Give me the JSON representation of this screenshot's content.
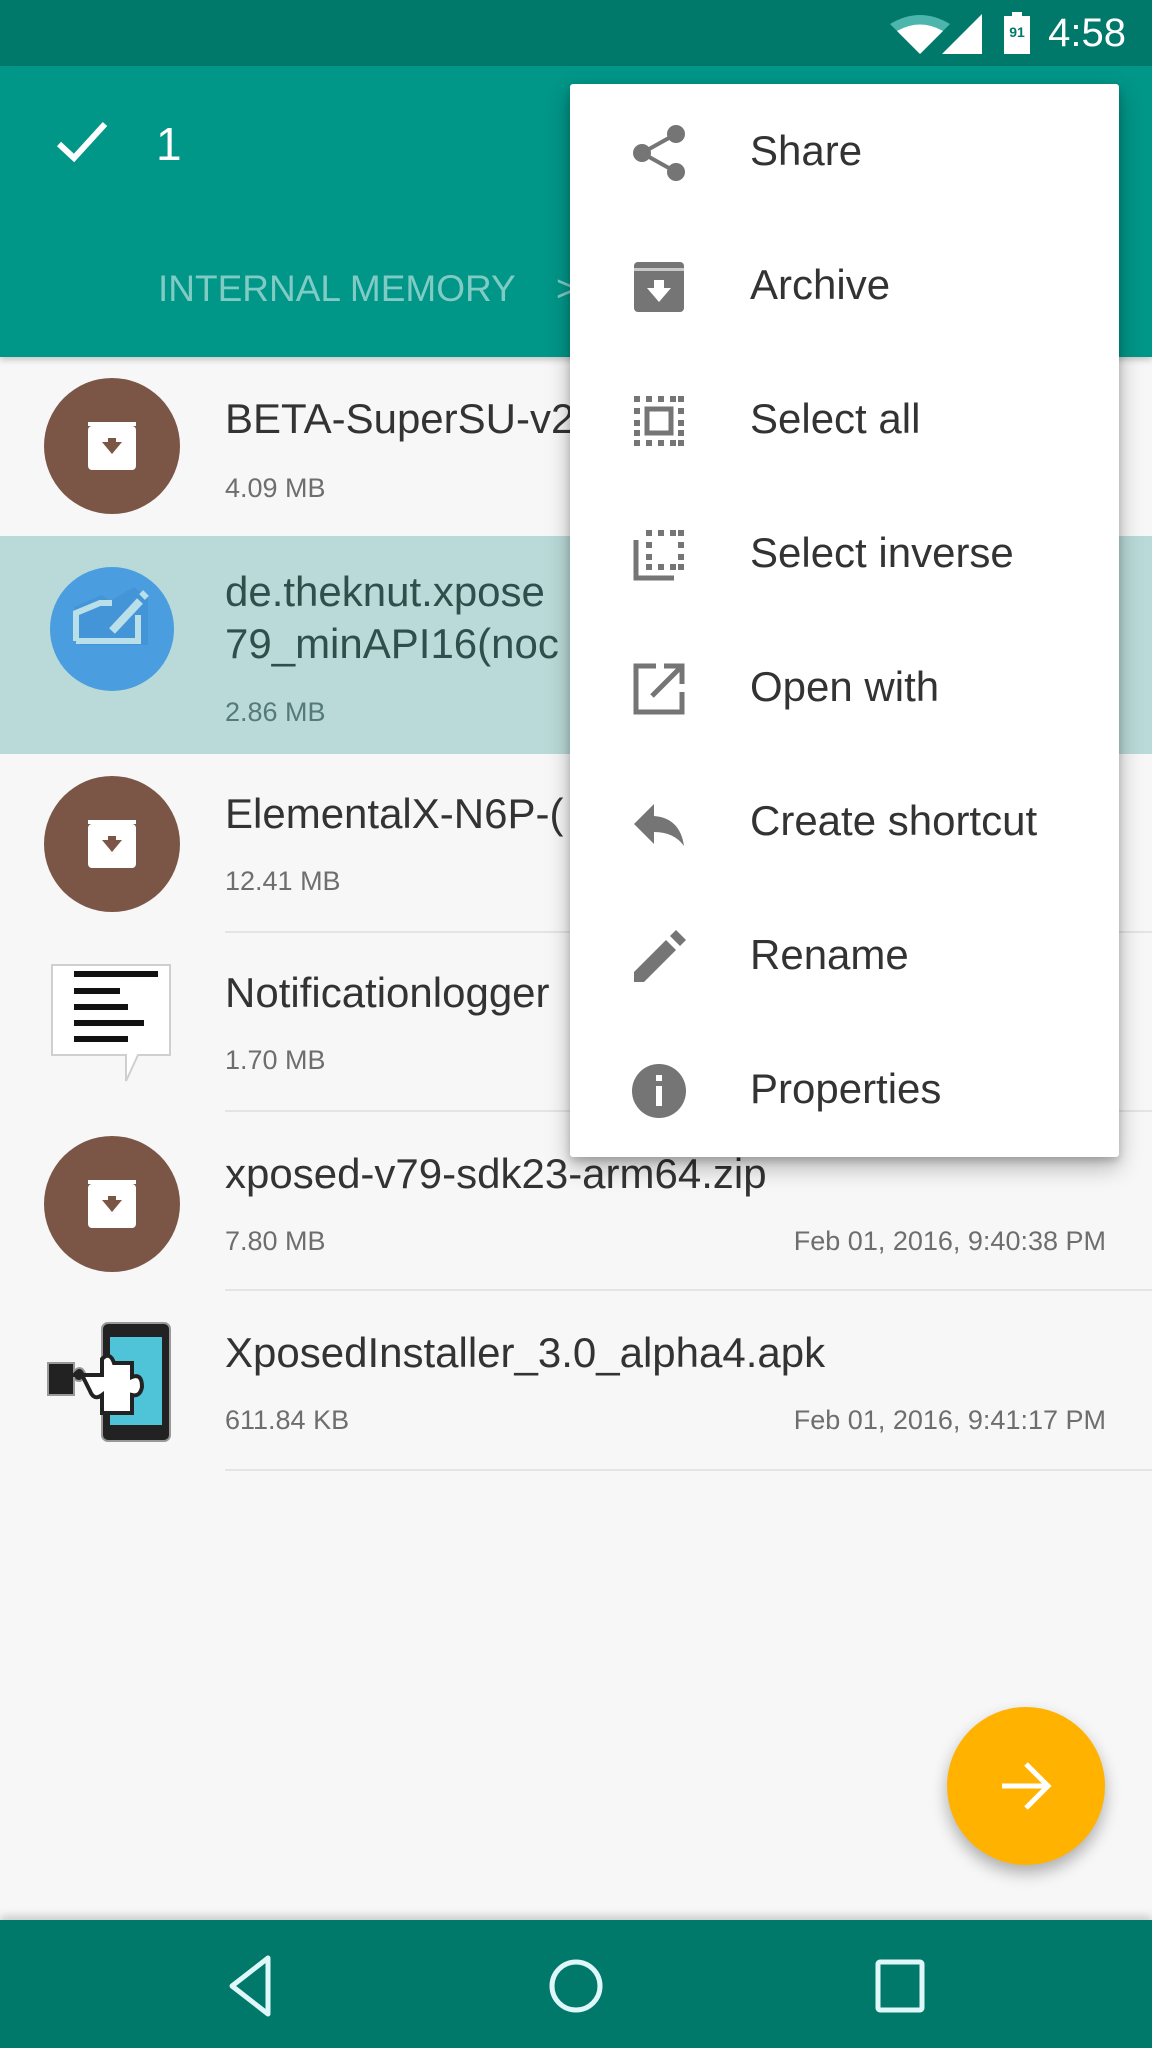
{
  "status_bar": {
    "time": "4:58",
    "battery_level": "91",
    "icons": [
      "wifi-icon",
      "cell-signal-icon",
      "battery-icon"
    ]
  },
  "toolbar": {
    "selected_count": "1",
    "breadcrumb": "INTERNAL MEMORY",
    "breadcrumb_separator": ">",
    "colors": {
      "primary": "#009688",
      "primary_dark": "#00796b",
      "breadcrumb_text": "#80cbc4"
    }
  },
  "files": [
    {
      "name": "BETA-SuperSU-v2",
      "size": "4.09 MB",
      "date": "",
      "icon": "archive-icon",
      "selected": false
    },
    {
      "name": "de.theknut.xpose",
      "name_line2": "79_minAPI16(noc",
      "size": "2.86 MB",
      "date": "",
      "icon": "xposed-module-icon",
      "selected": true
    },
    {
      "name": "ElementalX-N6P-(",
      "size": "12.41 MB",
      "date": "",
      "icon": "archive-icon",
      "selected": false
    },
    {
      "name": "Notificationlogger",
      "size": "1.70 MB",
      "date": "",
      "icon": "notification-logger-icon",
      "selected": false
    },
    {
      "name": "xposed-v79-sdk23-arm64.zip",
      "size": "7.80 MB",
      "date": "Feb 01, 2016, 9:40:38 PM",
      "icon": "archive-icon",
      "selected": false
    },
    {
      "name": "XposedInstaller_3.0_alpha4.apk",
      "size": "611.84 KB",
      "date": "Feb 01, 2016, 9:41:17 PM",
      "icon": "xposed-installer-icon",
      "selected": false
    }
  ],
  "menu": {
    "items": [
      {
        "label": "Share",
        "icon": "share-icon"
      },
      {
        "label": "Archive",
        "icon": "archive-icon"
      },
      {
        "label": "Select all",
        "icon": "select-all-icon"
      },
      {
        "label": "Select inverse",
        "icon": "select-inverse-icon"
      },
      {
        "label": "Open with",
        "icon": "open-with-icon"
      },
      {
        "label": "Create shortcut",
        "icon": "reply-icon"
      },
      {
        "label": "Rename",
        "icon": "pencil-icon"
      },
      {
        "label": "Properties",
        "icon": "info-icon"
      }
    ]
  },
  "fab": {
    "icon": "arrow-right-icon",
    "color": "#ffb300"
  },
  "nav_bar": {
    "buttons": [
      "back-icon",
      "home-icon",
      "recents-icon"
    ]
  },
  "colors": {
    "archive_icon_bg": "#7b5646",
    "selected_row_bg": "#b9dad8",
    "module_icon_bg": "#4a9ee0"
  }
}
